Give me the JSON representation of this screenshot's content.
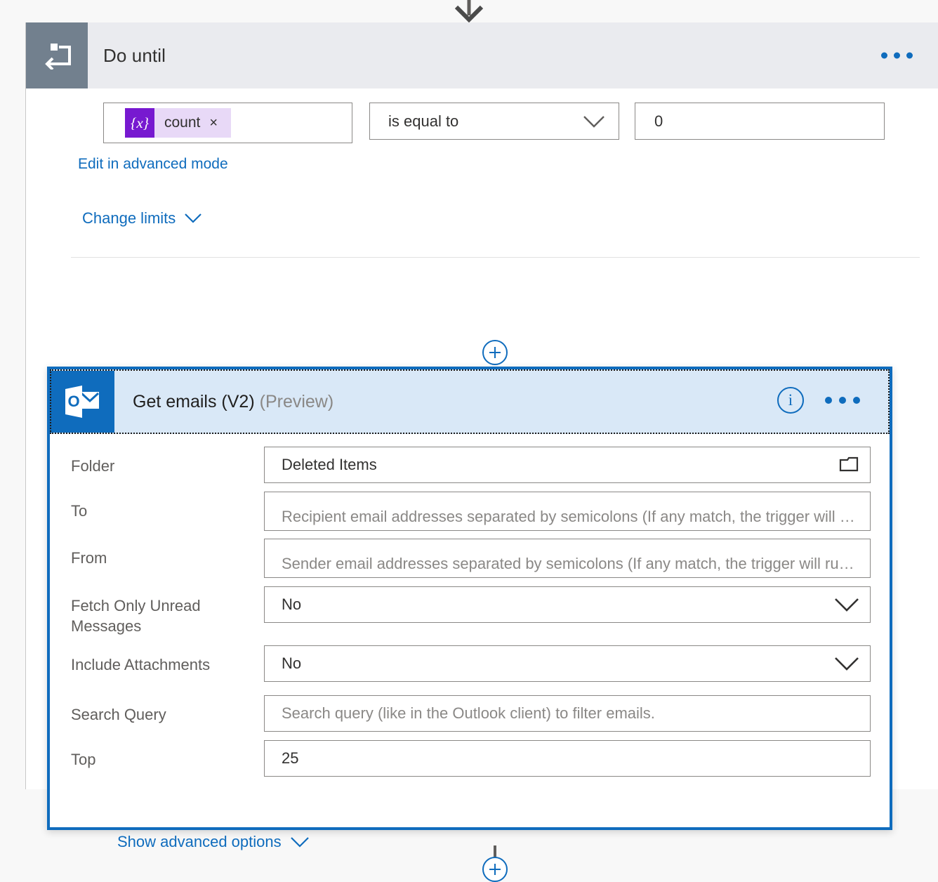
{
  "connector": {
    "top_arrow_icon": "arrow-down-icon",
    "plus_icon": "plus-icon"
  },
  "scope": {
    "icon": "do-until-loop-icon",
    "title": "Do until",
    "menu_icon": "ellipsis-icon",
    "condition": {
      "token_badge": "{x}",
      "token_label": "count",
      "token_remove": "×",
      "operator": "is equal to",
      "operator_chevron": "chevron-down-icon",
      "value": "0"
    },
    "links": {
      "advanced_mode": "Edit in advanced mode",
      "change_limits": "Change limits",
      "change_limits_chevron": "chevron-down-icon"
    }
  },
  "card": {
    "icon": "outlook-icon",
    "title": "Get emails (V2)",
    "preview_label": "(Preview)",
    "info_icon": "info-icon",
    "info_glyph": "i",
    "menu_icon": "ellipsis-icon",
    "fields": [
      {
        "label": "Folder",
        "value": "Deleted Items",
        "placeholder": "",
        "type": "picker",
        "trailing_icon": "folder-icon"
      },
      {
        "label": "To",
        "value": "",
        "placeholder": "Recipient email addresses separated by semicolons (If any match, the trigger will …",
        "type": "text",
        "trailing_icon": ""
      },
      {
        "label": "From",
        "value": "",
        "placeholder": "Sender email addresses separated by semicolons (If any match, the trigger will ru…",
        "type": "text",
        "trailing_icon": ""
      },
      {
        "label": "Fetch Only Unread Messages",
        "value": "No",
        "placeholder": "",
        "type": "select",
        "trailing_icon": "chevron-down-icon"
      },
      {
        "label": "Include Attachments",
        "value": "No",
        "placeholder": "",
        "type": "select",
        "trailing_icon": "chevron-down-icon"
      },
      {
        "label": "Search Query",
        "value": "",
        "placeholder": "Search query (like in the Outlook client) to filter emails.",
        "type": "text",
        "trailing_icon": ""
      },
      {
        "label": "Top",
        "value": "25",
        "placeholder": "",
        "type": "text",
        "trailing_icon": ""
      }
    ],
    "show_advanced": "Show advanced options",
    "show_advanced_chevron": "chevron-down-icon"
  },
  "colors": {
    "accent_blue": "#0f6cbd",
    "scope_icon_bg": "#72808e",
    "scope_header_bg": "#eaebef",
    "card_header_bg": "#d9e8f7",
    "token_badge": "#7719d0",
    "token_chip": "#e8d9f7"
  }
}
